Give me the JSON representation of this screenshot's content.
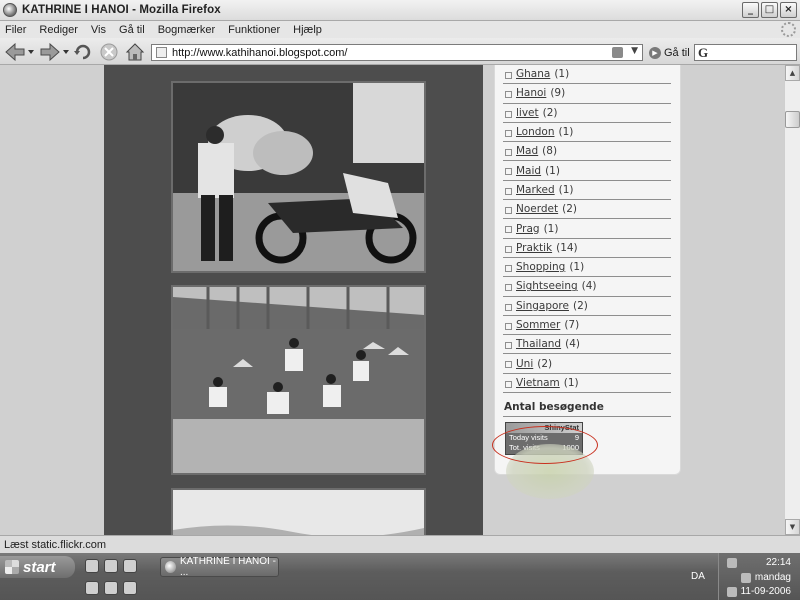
{
  "window": {
    "title": "KATHRINE I HANOI - Mozilla Firefox"
  },
  "title_controls": [
    "_",
    "□",
    "×"
  ],
  "menu": [
    "Filer",
    "Rediger",
    "Vis",
    "Gå til",
    "Bogmærker",
    "Funktioner",
    "Hjælp"
  ],
  "toolbar": {
    "url": "http://www.kathihanoi.blogspot.com/",
    "go_label": "Gå til",
    "search_engine_letter": "G"
  },
  "sidebar": {
    "labels": [
      {
        "name": "Ghana",
        "count": "(1)"
      },
      {
        "name": "Hanoi",
        "count": "(9)"
      },
      {
        "name": "livet",
        "count": "(2)"
      },
      {
        "name": "London",
        "count": "(1)"
      },
      {
        "name": "Mad",
        "count": "(8)"
      },
      {
        "name": "Maid",
        "count": "(1)"
      },
      {
        "name": "Marked",
        "count": "(1)"
      },
      {
        "name": "Noerdet",
        "count": "(2)"
      },
      {
        "name": "Prag",
        "count": "(1)"
      },
      {
        "name": "Praktik",
        "count": "(14)"
      },
      {
        "name": "Shopping",
        "count": "(1)"
      },
      {
        "name": "Sightseeing",
        "count": "(4)"
      },
      {
        "name": "Singapore",
        "count": "(2)"
      },
      {
        "name": "Sommer",
        "count": "(7)"
      },
      {
        "name": "Thailand",
        "count": "(4)"
      },
      {
        "name": "Uni",
        "count": "(2)"
      },
      {
        "name": "Vietnam",
        "count": "(1)"
      }
    ],
    "visitors_title": "Antal besøgende",
    "stat_widget": {
      "brand": "ShinyStat",
      "today_label": "Today visits",
      "today_value": "9",
      "total_label": "Tot. visits",
      "total_value": "1000"
    }
  },
  "status": {
    "text": "Læst static.flickr.com"
  },
  "taskbar": {
    "start_label": "start",
    "task_button_label": "KATHRINE I HANOI - ...",
    "language": "DA",
    "clock_time": "22:14",
    "clock_day": "mandag",
    "clock_date": "11-09-2006"
  },
  "colors": {
    "highlight_ellipse": "#c8301e"
  }
}
